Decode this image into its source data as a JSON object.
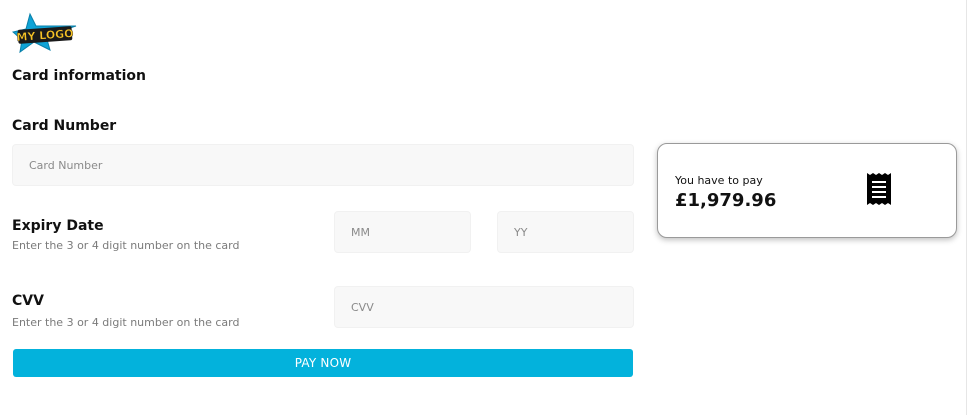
{
  "logo": {
    "text": "MY LOGO",
    "colors": {
      "star": "#0fa3d6",
      "text_fill": "#f7c325",
      "text_outline": "#1a1a1a"
    }
  },
  "form": {
    "title": "Card information",
    "card_number": {
      "label": "Card Number",
      "placeholder": "Card Number",
      "value": ""
    },
    "expiry": {
      "label": "Expiry Date",
      "hint": "Enter the 3 or 4 digit number on the card",
      "month_placeholder": "MM",
      "year_placeholder": "YY"
    },
    "cvv": {
      "label": "CVV",
      "hint": "Enter the 3 or 4 digit number on the card",
      "placeholder": "CVV"
    },
    "pay_button": {
      "label": "PAY NOW",
      "color": "#03b2dc"
    }
  },
  "summary": {
    "text": "You have to pay",
    "amount": "£1,979.96",
    "icon": "receipt-icon"
  }
}
